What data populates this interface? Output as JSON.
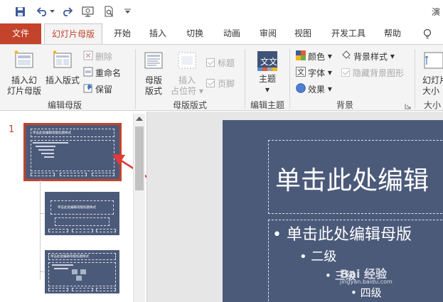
{
  "app": {
    "title_fragment": "演"
  },
  "tabs": [
    "文件",
    "幻灯片母版",
    "开始",
    "插入",
    "切换",
    "动画",
    "审阅",
    "视图",
    "开发工具",
    "帮助"
  ],
  "groups": {
    "edit_master": {
      "label": "编辑母版",
      "insert_master_line1": "插入幻",
      "insert_master_line2": "灯片母版",
      "insert_layout": "插入版式",
      "delete": "删除",
      "rename": "重命名",
      "preserve": "保留"
    },
    "master_layout": {
      "label": "母版版式",
      "master_layout_line1": "母版",
      "master_layout_line2": "版式",
      "insert_placeholder_line1": "插入",
      "insert_placeholder_line2": "占位符",
      "title_check": "标题",
      "footer_check": "页脚"
    },
    "edit_theme": {
      "label": "编辑主题",
      "themes": "主题"
    },
    "background": {
      "label": "背景",
      "colors": "颜色",
      "fonts": "字体",
      "effects": "效果",
      "bg_styles": "背景样式",
      "hide_bg": "隐藏背景图形"
    },
    "size": {
      "label": "大小",
      "slide_size_line1": "幻灯片",
      "slide_size_line2": "大小"
    }
  },
  "thumbnails": {
    "slide_number": "1",
    "thumb1_title": "单击此处编辑母版标题样式",
    "thumb2_title": "单击此处编辑母版标题样式",
    "thumb3_title": "单击此处编辑母版标题样式"
  },
  "slide": {
    "title": "单击此处编辑",
    "level1": "• 单击此处编辑母版",
    "level2": "• 二级",
    "level3": "• 三级",
    "level4": "• 四级"
  },
  "watermark": {
    "brand": "Bai 经验",
    "url": "jingyan.baidu.com"
  },
  "colors": {
    "file_tab": "#c4432b",
    "slide_bg": "#4c5a7a",
    "ribbon_bg": "#f4f4f4"
  }
}
